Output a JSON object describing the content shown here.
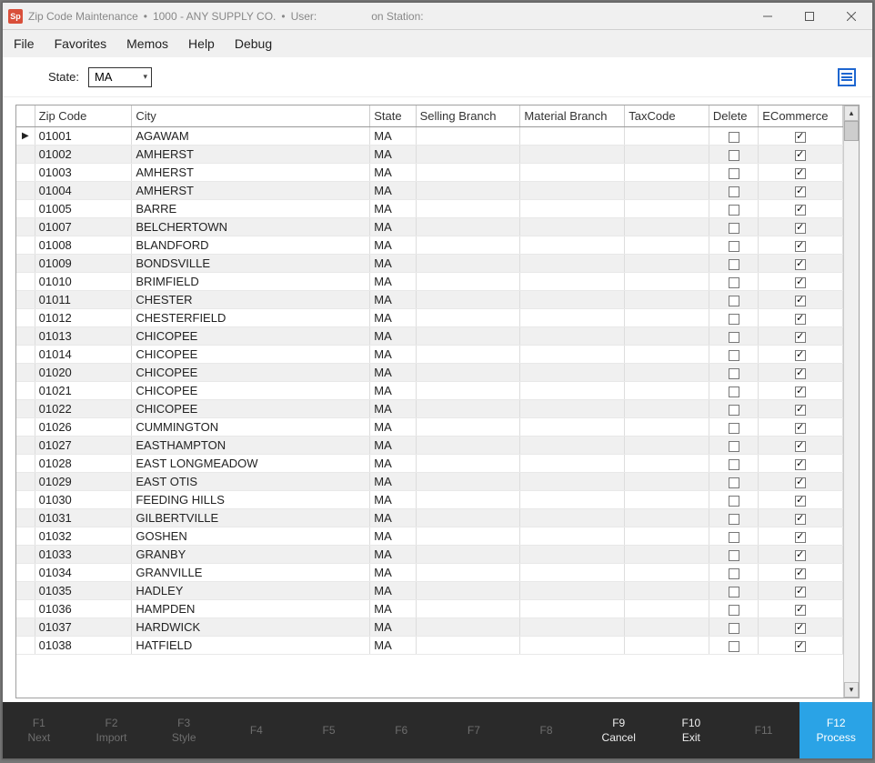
{
  "window": {
    "app_icon_text": "Sp",
    "title": "Zip Code Maintenance",
    "company": "1000 - ANY SUPPLY CO.",
    "user_label": "User:",
    "station_label": "on Station:"
  },
  "menu": {
    "items": [
      "File",
      "Favorites",
      "Memos",
      "Help",
      "Debug"
    ]
  },
  "toolbar": {
    "state_label": "State:",
    "state_value": "MA"
  },
  "grid": {
    "columns": [
      "",
      "Zip Code",
      "City",
      "State",
      "Selling Branch",
      "Material Branch",
      "TaxCode",
      "Delete",
      "ECommerce"
    ],
    "rows": [
      {
        "zip": "01001",
        "city": "AGAWAM",
        "state": "MA",
        "sb": "",
        "mb": "",
        "tax": "",
        "del": false,
        "ecom": true,
        "current": true
      },
      {
        "zip": "01002",
        "city": "AMHERST",
        "state": "MA",
        "sb": "",
        "mb": "",
        "tax": "",
        "del": false,
        "ecom": true
      },
      {
        "zip": "01003",
        "city": "AMHERST",
        "state": "MA",
        "sb": "",
        "mb": "",
        "tax": "",
        "del": false,
        "ecom": true
      },
      {
        "zip": "01004",
        "city": "AMHERST",
        "state": "MA",
        "sb": "",
        "mb": "",
        "tax": "",
        "del": false,
        "ecom": true
      },
      {
        "zip": "01005",
        "city": "BARRE",
        "state": "MA",
        "sb": "",
        "mb": "",
        "tax": "",
        "del": false,
        "ecom": true
      },
      {
        "zip": "01007",
        "city": "BELCHERTOWN",
        "state": "MA",
        "sb": "",
        "mb": "",
        "tax": "",
        "del": false,
        "ecom": true
      },
      {
        "zip": "01008",
        "city": "BLANDFORD",
        "state": "MA",
        "sb": "",
        "mb": "",
        "tax": "",
        "del": false,
        "ecom": true
      },
      {
        "zip": "01009",
        "city": "BONDSVILLE",
        "state": "MA",
        "sb": "",
        "mb": "",
        "tax": "",
        "del": false,
        "ecom": true
      },
      {
        "zip": "01010",
        "city": "BRIMFIELD",
        "state": "MA",
        "sb": "",
        "mb": "",
        "tax": "",
        "del": false,
        "ecom": true
      },
      {
        "zip": "01011",
        "city": "CHESTER",
        "state": "MA",
        "sb": "",
        "mb": "",
        "tax": "",
        "del": false,
        "ecom": true
      },
      {
        "zip": "01012",
        "city": "CHESTERFIELD",
        "state": "MA",
        "sb": "",
        "mb": "",
        "tax": "",
        "del": false,
        "ecom": true
      },
      {
        "zip": "01013",
        "city": "CHICOPEE",
        "state": "MA",
        "sb": "",
        "mb": "",
        "tax": "",
        "del": false,
        "ecom": true
      },
      {
        "zip": "01014",
        "city": "CHICOPEE",
        "state": "MA",
        "sb": "",
        "mb": "",
        "tax": "",
        "del": false,
        "ecom": true
      },
      {
        "zip": "01020",
        "city": "CHICOPEE",
        "state": "MA",
        "sb": "",
        "mb": "",
        "tax": "",
        "del": false,
        "ecom": true
      },
      {
        "zip": "01021",
        "city": "CHICOPEE",
        "state": "MA",
        "sb": "",
        "mb": "",
        "tax": "",
        "del": false,
        "ecom": true
      },
      {
        "zip": "01022",
        "city": "CHICOPEE",
        "state": "MA",
        "sb": "",
        "mb": "",
        "tax": "",
        "del": false,
        "ecom": true
      },
      {
        "zip": "01026",
        "city": "CUMMINGTON",
        "state": "MA",
        "sb": "",
        "mb": "",
        "tax": "",
        "del": false,
        "ecom": true
      },
      {
        "zip": "01027",
        "city": "EASTHAMPTON",
        "state": "MA",
        "sb": "",
        "mb": "",
        "tax": "",
        "del": false,
        "ecom": true
      },
      {
        "zip": "01028",
        "city": "EAST LONGMEADOW",
        "state": "MA",
        "sb": "",
        "mb": "",
        "tax": "",
        "del": false,
        "ecom": true
      },
      {
        "zip": "01029",
        "city": "EAST OTIS",
        "state": "MA",
        "sb": "",
        "mb": "",
        "tax": "",
        "del": false,
        "ecom": true
      },
      {
        "zip": "01030",
        "city": "FEEDING HILLS",
        "state": "MA",
        "sb": "",
        "mb": "",
        "tax": "",
        "del": false,
        "ecom": true
      },
      {
        "zip": "01031",
        "city": "GILBERTVILLE",
        "state": "MA",
        "sb": "",
        "mb": "",
        "tax": "",
        "del": false,
        "ecom": true
      },
      {
        "zip": "01032",
        "city": "GOSHEN",
        "state": "MA",
        "sb": "",
        "mb": "",
        "tax": "",
        "del": false,
        "ecom": true
      },
      {
        "zip": "01033",
        "city": "GRANBY",
        "state": "MA",
        "sb": "",
        "mb": "",
        "tax": "",
        "del": false,
        "ecom": true
      },
      {
        "zip": "01034",
        "city": "GRANVILLE",
        "state": "MA",
        "sb": "",
        "mb": "",
        "tax": "",
        "del": false,
        "ecom": true
      },
      {
        "zip": "01035",
        "city": "HADLEY",
        "state": "MA",
        "sb": "",
        "mb": "",
        "tax": "",
        "del": false,
        "ecom": true
      },
      {
        "zip": "01036",
        "city": "HAMPDEN",
        "state": "MA",
        "sb": "",
        "mb": "",
        "tax": "",
        "del": false,
        "ecom": true
      },
      {
        "zip": "01037",
        "city": "HARDWICK",
        "state": "MA",
        "sb": "",
        "mb": "",
        "tax": "",
        "del": false,
        "ecom": true
      },
      {
        "zip": "01038",
        "city": "HATFIELD",
        "state": "MA",
        "sb": "",
        "mb": "",
        "tax": "",
        "del": false,
        "ecom": true
      }
    ]
  },
  "fkeys": [
    {
      "key": "F1",
      "label": "Next",
      "state": "disabled"
    },
    {
      "key": "F2",
      "label": "Import",
      "state": "disabled"
    },
    {
      "key": "F3",
      "label": "Style",
      "state": "disabled"
    },
    {
      "key": "F4",
      "label": "",
      "state": "disabled"
    },
    {
      "key": "F5",
      "label": "",
      "state": "disabled"
    },
    {
      "key": "F6",
      "label": "",
      "state": "disabled"
    },
    {
      "key": "F7",
      "label": "",
      "state": "disabled"
    },
    {
      "key": "F8",
      "label": "",
      "state": "disabled"
    },
    {
      "key": "F9",
      "label": "Cancel",
      "state": "enabled"
    },
    {
      "key": "F10",
      "label": "Exit",
      "state": "enabled"
    },
    {
      "key": "F11",
      "label": "",
      "state": "disabled"
    },
    {
      "key": "F12",
      "label": "Process",
      "state": "primary"
    }
  ]
}
